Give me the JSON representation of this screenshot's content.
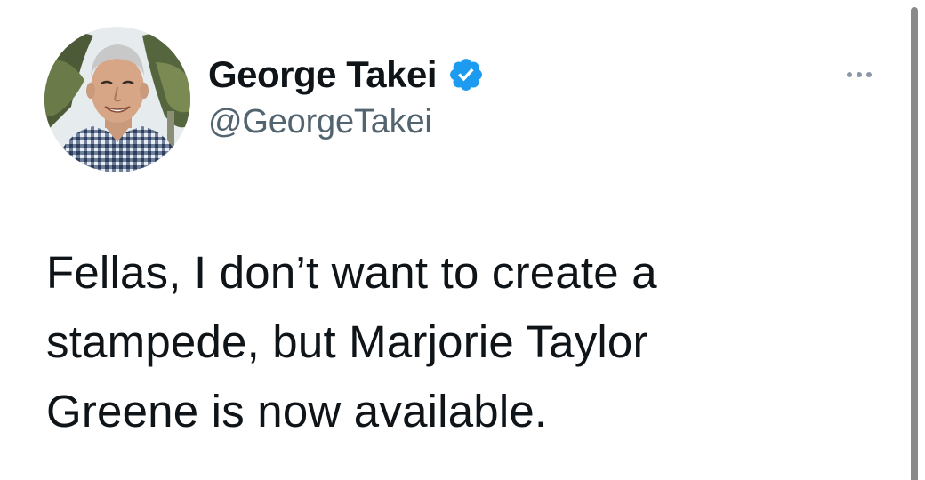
{
  "tweet": {
    "author": {
      "display_name": "George Takei",
      "handle": "@GeorgeTakei",
      "verified": true,
      "verified_icon": "verified-badge-icon",
      "avatar": "profile-photo"
    },
    "more_icon": "more-options-icon",
    "text": "Fellas, I don’t want to create a\nstampede, but Marjorie Taylor\nGreene is now available."
  },
  "colors": {
    "name": "#0f1419",
    "handle": "#536471",
    "verified": "#1d9bf0",
    "more_dots": "#8b98a5",
    "scrollbar": "#8a8a8a"
  }
}
